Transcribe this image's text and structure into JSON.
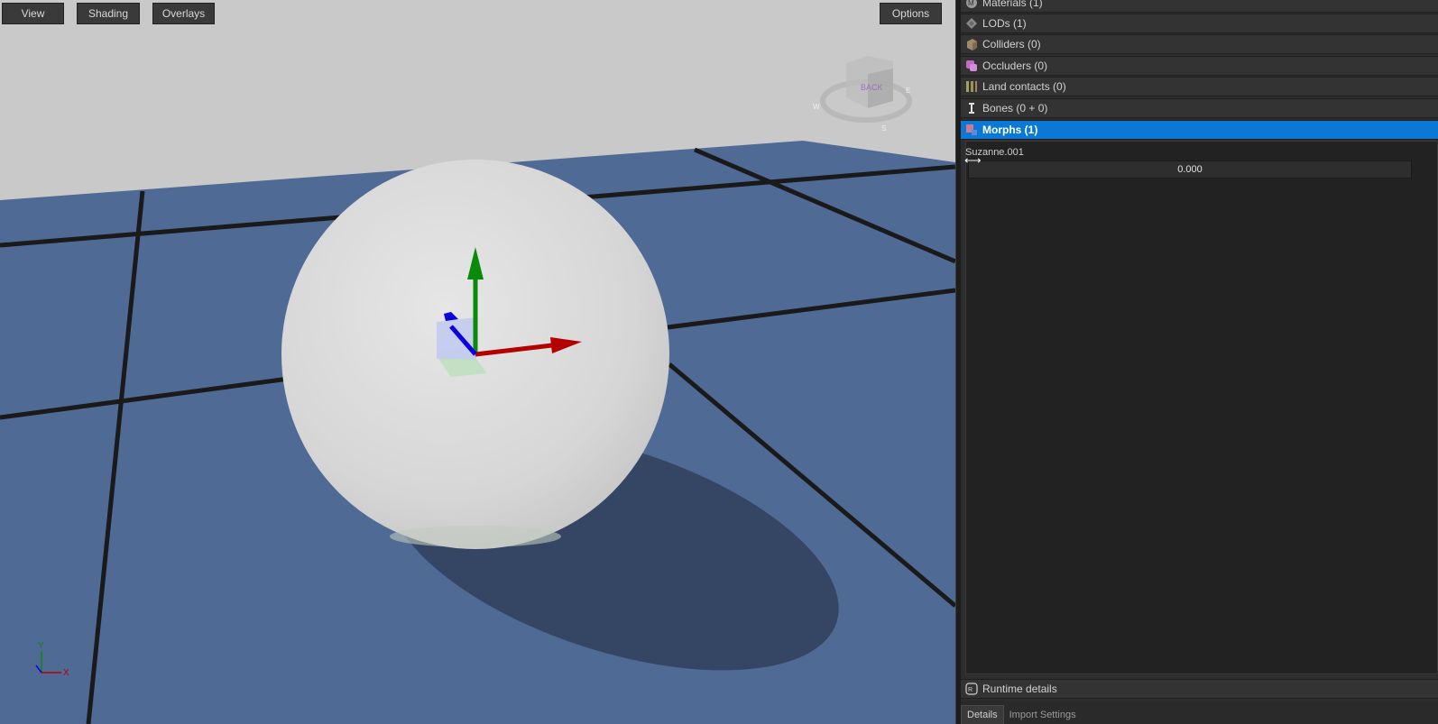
{
  "viewport": {
    "buttons": {
      "view": "View",
      "shading": "Shading",
      "overlays": "Overlays",
      "options": "Options"
    },
    "view_cube_label": "BACK",
    "compass": {
      "w": "W",
      "e": "E",
      "s": "S"
    },
    "axis": {
      "y": "Y",
      "x": "X"
    },
    "colors": {
      "wall": "#c9c9c9",
      "floor": "#4f6a95",
      "sphere": "#dcdcdc",
      "x_axis": "#b50000",
      "y_axis": "#0a8a0a",
      "z_axis": "#0a00e0"
    }
  },
  "panel": {
    "sections": [
      {
        "label": "Materials (1)",
        "icon": "materials-icon"
      },
      {
        "label": "LODs (1)",
        "icon": "lods-icon"
      },
      {
        "label": "Colliders (0)",
        "icon": "colliders-icon"
      },
      {
        "label": "Occluders (0)",
        "icon": "occluders-icon"
      },
      {
        "label": "Land contacts (0)",
        "icon": "land-contacts-icon"
      },
      {
        "label": "Bones (0 + 0)",
        "icon": "bones-icon"
      },
      {
        "label": "Morphs (1)",
        "icon": "morphs-icon",
        "selected": true
      }
    ],
    "morph": {
      "name": "Suzanne.001",
      "value": "0.000"
    },
    "runtime_details": "Runtime details",
    "tabs": {
      "details": "Details",
      "import_settings": "Import Settings"
    },
    "accent": "#0a78d4"
  }
}
